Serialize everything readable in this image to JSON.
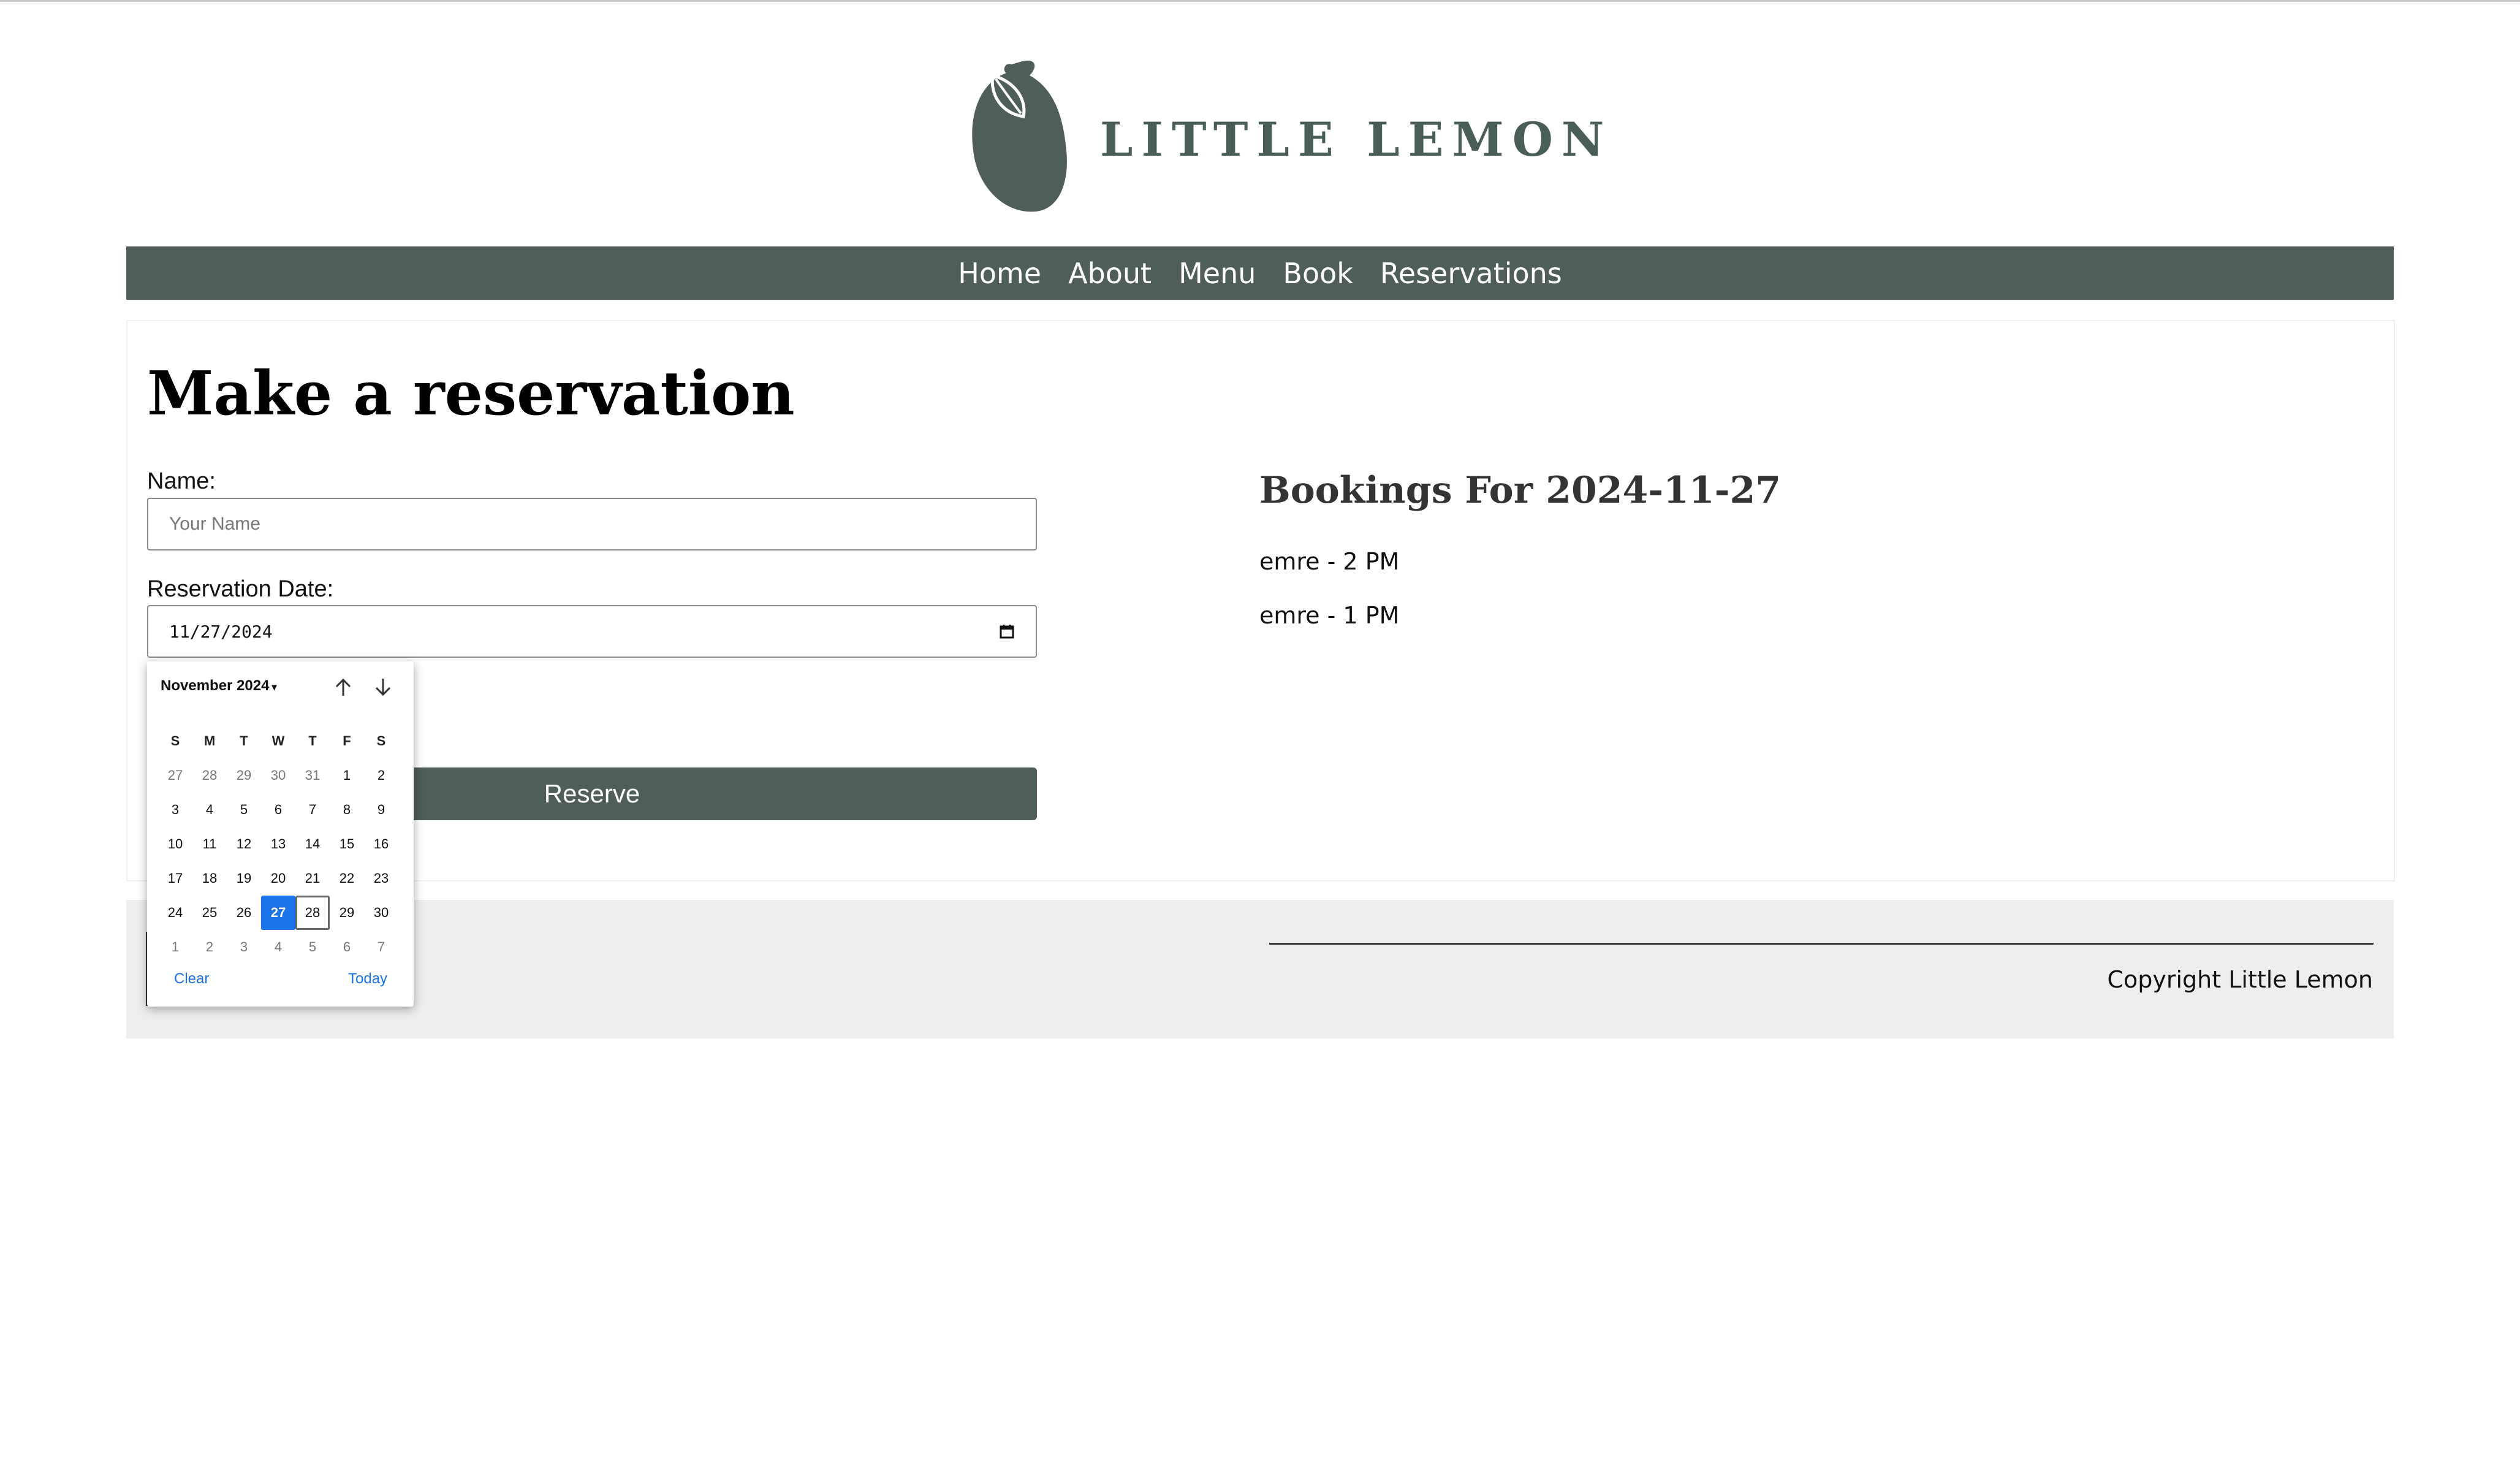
{
  "brand": {
    "name": "LITTLE LEMON",
    "color": "#495e57"
  },
  "nav": {
    "items": [
      "Home",
      "About",
      "Menu",
      "Book",
      "Reservations"
    ]
  },
  "form": {
    "title": "Make a reservation",
    "name_label": "Name:",
    "name_placeholder": "Your Name",
    "name_value": "",
    "date_label": "Reservation Date:",
    "date_value": "11/27/2024",
    "submit_label": "Reserve"
  },
  "bookings": {
    "title": "Bookings For 2024-11-27",
    "items": [
      "emre - 2 PM",
      "emre - 1 PM"
    ]
  },
  "footer": {
    "copyright": "Copyright Little Lemon"
  },
  "datepicker": {
    "month_label": "November 2024",
    "weekdays": [
      "S",
      "M",
      "T",
      "W",
      "T",
      "F",
      "S"
    ],
    "weeks": [
      [
        "27",
        "28",
        "29",
        "30",
        "31",
        "1",
        "2"
      ],
      [
        "3",
        "4",
        "5",
        "6",
        "7",
        "8",
        "9"
      ],
      [
        "10",
        "11",
        "12",
        "13",
        "14",
        "15",
        "16"
      ],
      [
        "17",
        "18",
        "19",
        "20",
        "21",
        "22",
        "23"
      ],
      [
        "24",
        "25",
        "26",
        "27",
        "28",
        "29",
        "30"
      ],
      [
        "1",
        "2",
        "3",
        "4",
        "5",
        "6",
        "7"
      ]
    ],
    "selected_day": "27",
    "focused_day": "28",
    "clear_label": "Clear",
    "today_label": "Today",
    "accent_color": "#1a73e8"
  },
  "colors": {
    "primary": "#4f5e57",
    "footer_bg": "#edeeed"
  }
}
